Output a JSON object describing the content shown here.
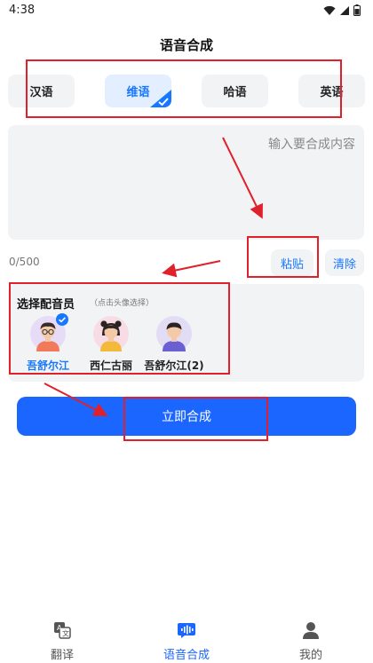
{
  "status_bar": {
    "time": "4:38",
    "icons": [
      "wifi-icon",
      "signal-icon",
      "battery-icon"
    ]
  },
  "header": {
    "title": "语音合成"
  },
  "languages": [
    {
      "label": "汉语",
      "selected": false
    },
    {
      "label": "维语",
      "selected": true
    },
    {
      "label": "哈语",
      "selected": false
    },
    {
      "label": "英语",
      "selected": false
    }
  ],
  "editor": {
    "placeholder": "输入要合成内容",
    "char_count": "0/500",
    "paste_label": "粘贴",
    "clear_label": "清除"
  },
  "voice_panel": {
    "title": "选择配音员",
    "hint": "（点击头像选择）",
    "voices": [
      {
        "name": "吾舒尔江",
        "selected": true,
        "icon": "male-avatar-glasses-icon"
      },
      {
        "name": "西仁古丽",
        "selected": false,
        "icon": "female-avatar-icon"
      },
      {
        "name": "吾舒尔江(2)",
        "selected": false,
        "icon": "male-avatar-icon"
      }
    ]
  },
  "action": {
    "synthesize_label": "立即合成"
  },
  "tab_bar": {
    "items": [
      {
        "label": "翻译",
        "icon": "translate-icon",
        "active": false
      },
      {
        "label": "语音合成",
        "icon": "voice-synthesis-icon",
        "active": true
      },
      {
        "label": "我的",
        "icon": "profile-icon",
        "active": false
      }
    ]
  },
  "colors": {
    "accent": "#1a66ff",
    "panel_bg": "#f2f3f5",
    "annotation": "#e0202a"
  }
}
